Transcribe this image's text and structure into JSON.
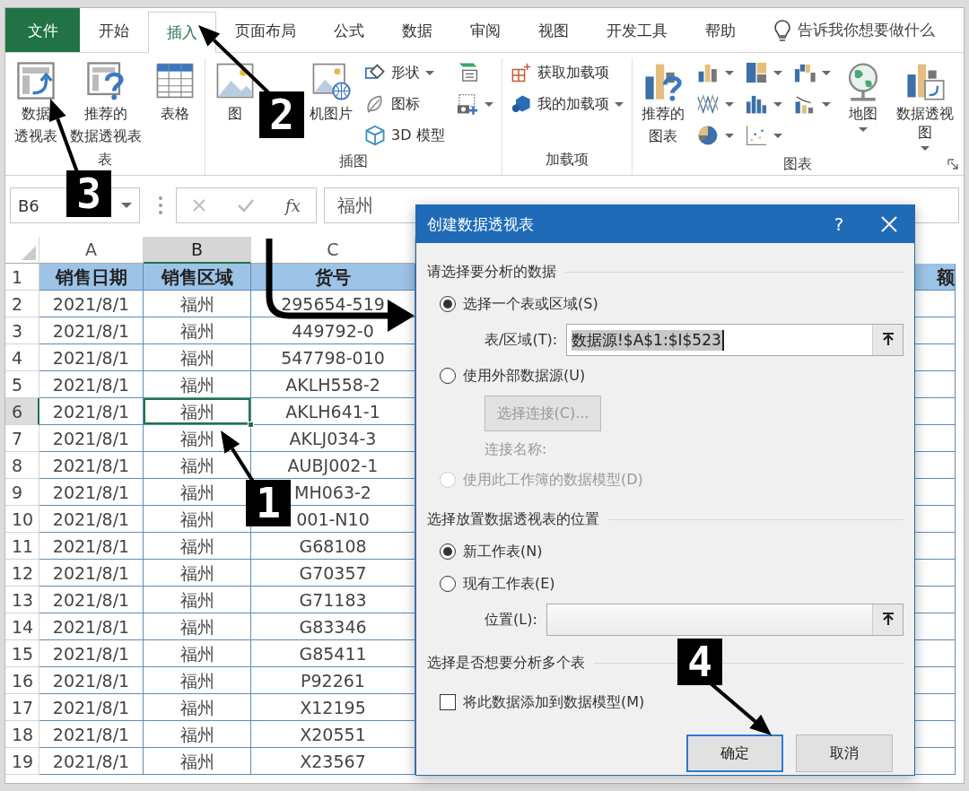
{
  "tabs": [
    {
      "label": "文件",
      "kind": "file",
      "selected": false
    },
    {
      "label": "开始",
      "kind": "tab",
      "selected": false
    },
    {
      "label": "插入",
      "kind": "tab",
      "selected": true
    },
    {
      "label": "页面布局",
      "kind": "tab",
      "selected": false
    },
    {
      "label": "公式",
      "kind": "tab",
      "selected": false
    },
    {
      "label": "数据",
      "kind": "tab",
      "selected": false
    },
    {
      "label": "审阅",
      "kind": "tab",
      "selected": false
    },
    {
      "label": "视图",
      "kind": "tab",
      "selected": false
    },
    {
      "label": "开发工具",
      "kind": "tab",
      "selected": false
    },
    {
      "label": "帮助",
      "kind": "tab",
      "selected": false
    }
  ],
  "tell_me": {
    "text": "告诉我你想要做什么"
  },
  "ribbon": {
    "groups": [
      {
        "label": "表",
        "columns": [
          [
            {
              "kind": "large",
              "label": [
                "数据",
                "透视表"
              ]
            }
          ],
          [
            {
              "kind": "large",
              "label": [
                "推荐的",
                "数据透视表"
              ]
            }
          ],
          [
            {
              "kind": "large",
              "label": "表格"
            }
          ]
        ]
      },
      {
        "label": "插图",
        "columns": [
          [
            {
              "kind": "large",
              "label": "图"
            }
          ],
          [
            {
              "kind": "large",
              "label": "机图片"
            }
          ],
          [
            {
              "kind": "small",
              "label": "形状",
              "dropdown": true
            },
            {
              "kind": "small",
              "label": "图标"
            },
            {
              "kind": "small",
              "label": "3D 模型"
            }
          ],
          [
            {
              "kind": "icon"
            },
            {
              "kind": "icon",
              "dropdown": true
            }
          ]
        ]
      },
      {
        "label": "加载项",
        "columns": [
          [
            {
              "kind": "small",
              "label": "获取加载项"
            },
            {
              "kind": "small",
              "label": "我的加载项",
              "dropdown": true
            }
          ]
        ]
      },
      {
        "label": "图表",
        "launcher": true,
        "columns": [
          [
            {
              "kind": "large",
              "label": [
                "推荐的",
                "图表"
              ]
            }
          ],
          [
            {
              "kind": "icon",
              "dropdown": true
            },
            {
              "kind": "icon",
              "dropdown": true
            },
            {
              "kind": "icon",
              "dropdown": true
            }
          ],
          [
            {
              "kind": "icon",
              "dropdown": true
            },
            {
              "kind": "icon",
              "dropdown": true
            },
            {
              "kind": "icon",
              "dropdown": true
            }
          ],
          [
            {
              "kind": "icon",
              "dropdown": true
            },
            {
              "kind": "icon",
              "dropdown": true
            }
          ],
          [
            {
              "kind": "large",
              "label": "地图",
              "dropdown": true
            }
          ],
          [
            {
              "kind": "large",
              "label": "数据透视图",
              "dropdown": true
            }
          ]
        ]
      }
    ]
  },
  "formula_bar": {
    "name_box": "B6",
    "fx": "fx",
    "formula": "福州"
  },
  "sheet": {
    "columns": [
      {
        "label": "A",
        "selected": false
      },
      {
        "label": "B",
        "selected": true
      },
      {
        "label": "C",
        "selected": false
      }
    ],
    "rows": [
      {
        "number": "1",
        "kind": "header",
        "selected": false,
        "cells": [
          "销售日期",
          "销售区域",
          "货号",
          "额"
        ]
      },
      {
        "number": "2",
        "kind": "data",
        "selected": false,
        "cells": [
          "2021/8/1",
          "福州",
          "295654-519"
        ]
      },
      {
        "number": "3",
        "kind": "data",
        "selected": false,
        "cells": [
          "2021/8/1",
          "福州",
          "449792-0"
        ]
      },
      {
        "number": "4",
        "kind": "data",
        "selected": false,
        "cells": [
          "2021/8/1",
          "福州",
          "547798-010"
        ]
      },
      {
        "number": "5",
        "kind": "data",
        "selected": false,
        "cells": [
          "2021/8/1",
          "福州",
          "AKLH558-2"
        ]
      },
      {
        "number": "6",
        "kind": "data",
        "selected": true,
        "cells": [
          "2021/8/1",
          "福州",
          "AKLH641-1"
        ]
      },
      {
        "number": "7",
        "kind": "data",
        "selected": false,
        "cells": [
          "2021/8/1",
          "福州",
          "AKLJ034-3"
        ]
      },
      {
        "number": "8",
        "kind": "data",
        "selected": false,
        "cells": [
          "2021/8/1",
          "福州",
          "AUBJ002-1"
        ]
      },
      {
        "number": "9",
        "kind": "data",
        "selected": false,
        "cells": [
          "2021/8/1",
          "福州",
          "MH063-2"
        ]
      },
      {
        "number": "10",
        "kind": "data",
        "selected": false,
        "cells": [
          "2021/8/1",
          "福州",
          "001-N10"
        ]
      },
      {
        "number": "11",
        "kind": "data",
        "selected": false,
        "cells": [
          "2021/8/1",
          "福州",
          "G68108"
        ]
      },
      {
        "number": "12",
        "kind": "data",
        "selected": false,
        "cells": [
          "2021/8/1",
          "福州",
          "G70357"
        ]
      },
      {
        "number": "13",
        "kind": "data",
        "selected": false,
        "cells": [
          "2021/8/1",
          "福州",
          "G71183"
        ]
      },
      {
        "number": "14",
        "kind": "data",
        "selected": false,
        "cells": [
          "2021/8/1",
          "福州",
          "G83346"
        ]
      },
      {
        "number": "15",
        "kind": "data",
        "selected": false,
        "cells": [
          "2021/8/1",
          "福州",
          "G85411"
        ]
      },
      {
        "number": "16",
        "kind": "data",
        "selected": false,
        "cells": [
          "2021/8/1",
          "福州",
          "P92261"
        ]
      },
      {
        "number": "17",
        "kind": "data",
        "selected": false,
        "cells": [
          "2021/8/1",
          "福州",
          "X12195"
        ]
      },
      {
        "number": "18",
        "kind": "data",
        "selected": false,
        "cells": [
          "2021/8/1",
          "福州",
          "X20551"
        ]
      },
      {
        "number": "19",
        "kind": "data",
        "selected": false,
        "cells": [
          "2021/8/1",
          "福州",
          "X23567"
        ]
      }
    ]
  },
  "dialog": {
    "title": "创建数据透视表",
    "help": "?",
    "sections": [
      {
        "heading": "请选择要分析的数据",
        "items": [
          {
            "kind": "radio",
            "label": "选择一个表或区域(S)",
            "selected": true,
            "disabled": false
          },
          {
            "kind": "field",
            "label": "表/区域(T):",
            "value": "数据源!$A$1:$I$523",
            "value_selected": true,
            "disabled": false
          },
          {
            "kind": "radio",
            "label": "使用外部数据源(U)",
            "selected": false,
            "disabled": false
          },
          {
            "kind": "button",
            "label": "选择连接(C)...",
            "disabled": true
          },
          {
            "kind": "note",
            "label": "连接名称:",
            "disabled": true
          },
          {
            "kind": "radio",
            "label": "使用此工作簿的数据模型(D)",
            "selected": false,
            "disabled": true
          }
        ]
      },
      {
        "heading": "选择放置数据透视表的位置",
        "items": [
          {
            "kind": "radio",
            "label": "新工作表(N)",
            "selected": true,
            "disabled": false
          },
          {
            "kind": "radio",
            "label": "现有工作表(E)",
            "selected": false,
            "disabled": false
          },
          {
            "kind": "field",
            "label": "位置(L):",
            "disabled": true
          }
        ]
      },
      {
        "heading": "选择是否想要分析多个表",
        "items": [
          {
            "kind": "checkbox",
            "label": "将此数据添加到数据模型(M)",
            "checked": false
          }
        ]
      }
    ],
    "buttons": [
      {
        "label": "确定",
        "default": true
      },
      {
        "label": "取消",
        "default": false
      }
    ]
  },
  "annotations": [
    {
      "label": "1"
    },
    {
      "label": "2"
    },
    {
      "label": "3"
    },
    {
      "label": "4"
    }
  ]
}
